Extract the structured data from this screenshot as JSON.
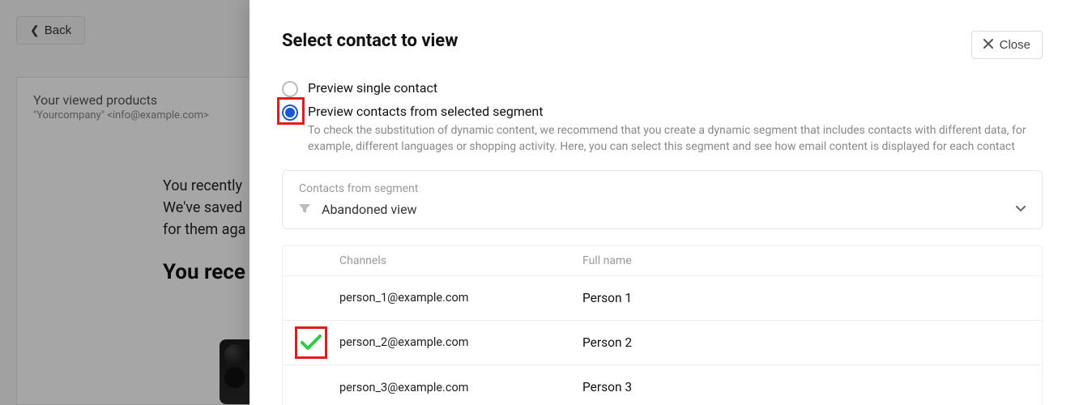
{
  "background": {
    "back_label": "Back",
    "email_subject": "Your viewed products",
    "email_from": "\"Yourcompany\" <info@example.com>",
    "body_line1": "You recently",
    "body_line2": "We've saved",
    "body_line3": "for them aga",
    "body_heading": "You rece"
  },
  "modal": {
    "title": "Select contact to view",
    "close_label": "Close",
    "radios": {
      "single_label": "Preview single contact",
      "segment_label": "Preview contacts from selected segment",
      "segment_help": "To check the substitution of dynamic content, we recommend that you create a dynamic segment that includes contacts with different data, for example, different languages or shopping activity. Here, you can select this segment and see how email content is displayed for each contact"
    },
    "segment": {
      "caption": "Contacts from segment",
      "selected": "Abandoned view"
    },
    "table": {
      "header_channels": "Channels",
      "header_fullname": "Full name",
      "rows": [
        {
          "email": "person_1@example.com",
          "name": "Person 1",
          "checked": false
        },
        {
          "email": "person_2@example.com",
          "name": "Person 2",
          "checked": true
        },
        {
          "email": "person_3@example.com",
          "name": "Person 3",
          "checked": false
        }
      ]
    }
  }
}
